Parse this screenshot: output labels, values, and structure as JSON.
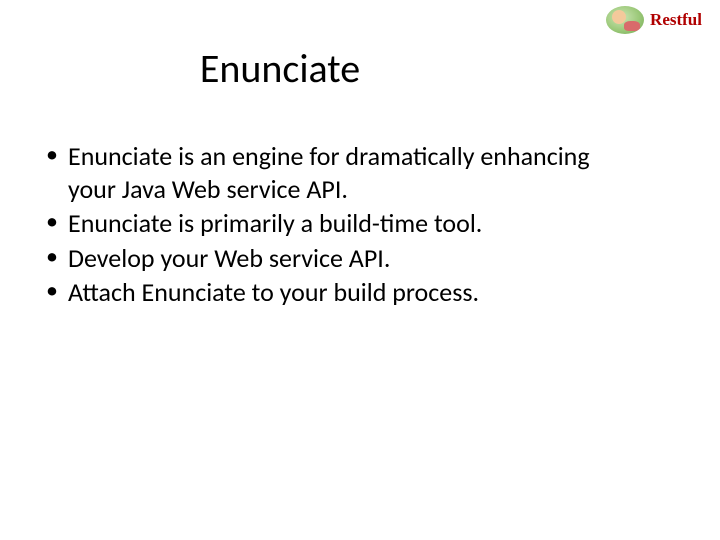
{
  "badge": {
    "label": "Restful"
  },
  "title": "Enunciate",
  "bullets": [
    "Enunciate is an engine for dramatically enhancing your Java Web service API.",
    "Enunciate is primarily a build-time tool.",
    "Develop your Web service API.",
    "Attach Enunciate to your build process."
  ]
}
